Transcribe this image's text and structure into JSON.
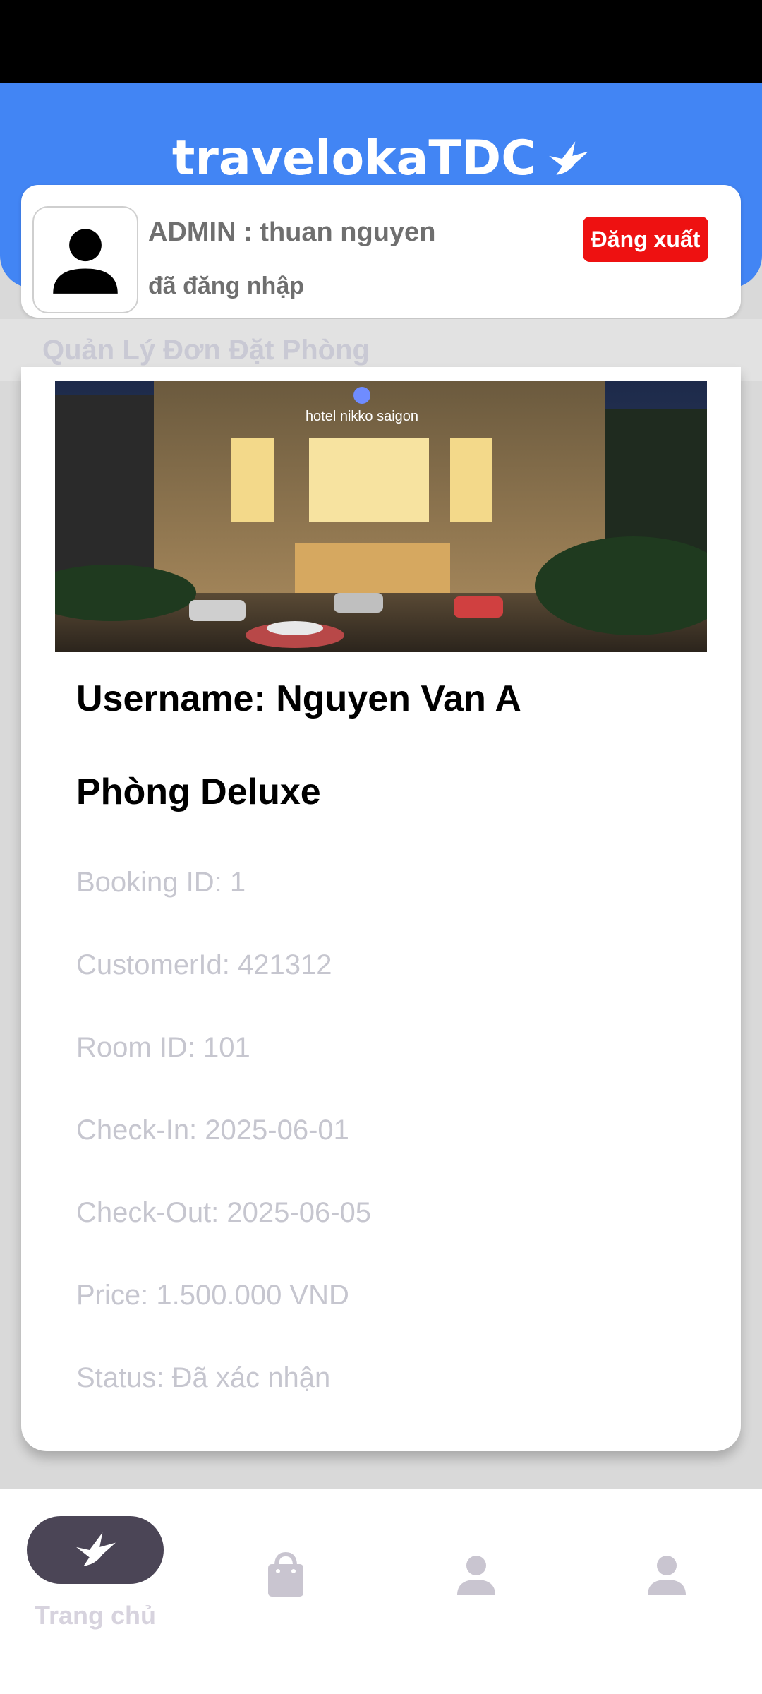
{
  "app": {
    "brand": "travelokaTDC"
  },
  "user_card": {
    "admin_line": "ADMIN : thuan nguyen",
    "status_line": "đã đăng nhập",
    "logout_label": "Đăng xuất"
  },
  "section": {
    "title": "Quản Lý Đơn Đặt Phòng"
  },
  "booking": {
    "image_sign": "hotel nikko saigon",
    "username": "Username: Nguyen Van A",
    "room_name": "Phòng Deluxe",
    "booking_id": "Booking ID: 1",
    "customer_id": "CustomerId: 421312",
    "room_id": "Room ID: 101",
    "check_in": "Check-In: 2025-06-01",
    "check_out": "Check-Out: 2025-06-05",
    "price": "Price: 1.500.000 VND",
    "status": "Status: Đã xác nhận"
  },
  "bottom_nav": {
    "items": [
      {
        "label": "Trang chủ",
        "icon": "bird-icon",
        "active": true
      },
      {
        "label": "",
        "icon": "shopping-bag-icon",
        "active": false
      },
      {
        "label": "",
        "icon": "person-icon",
        "active": false
      },
      {
        "label": "",
        "icon": "person-icon",
        "active": false
      }
    ]
  },
  "colors": {
    "header": "#4285f4",
    "logout": "#ee1111",
    "nav_active": "#4b4556"
  }
}
